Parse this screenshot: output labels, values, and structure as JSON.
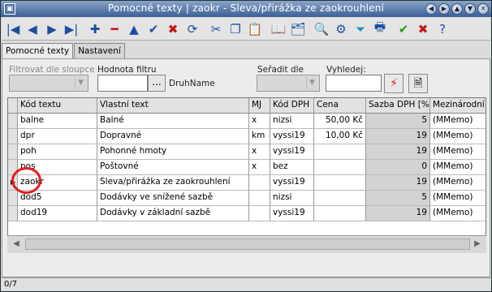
{
  "window": {
    "title": "Pomocné texty | zaokr - Sleva/přirážka ze zaokrouhlení",
    "icon": "app-icon"
  },
  "title_buttons": [
    "◀",
    "▶",
    "▲",
    "▼",
    "✕"
  ],
  "toolbar": [
    {
      "name": "first-record-icon",
      "glyph": "|◀"
    },
    {
      "name": "previous-record-icon",
      "glyph": "◀"
    },
    {
      "name": "next-record-icon",
      "glyph": "▶"
    },
    {
      "name": "last-record-icon",
      "glyph": "▶|"
    },
    {
      "name": "add-icon",
      "glyph": "✚"
    },
    {
      "name": "delete-icon",
      "glyph": "━"
    },
    {
      "name": "edit-icon",
      "glyph": "▲"
    },
    {
      "name": "confirm-icon",
      "glyph": "✔"
    },
    {
      "name": "cancel-icon",
      "glyph": "✖"
    },
    {
      "name": "refresh-icon",
      "glyph": "⟳"
    },
    {
      "name": "cut-icon",
      "glyph": "✂"
    },
    {
      "name": "copy-icon",
      "glyph": "❐"
    },
    {
      "name": "paste-icon",
      "glyph": "📋"
    },
    {
      "name": "book-icon",
      "glyph": "📖"
    },
    {
      "name": "folder-icon",
      "glyph": "🗂"
    },
    {
      "name": "search-icon",
      "glyph": "🔍"
    },
    {
      "name": "settings-icon",
      "glyph": "⚙"
    },
    {
      "name": "filter-icon",
      "glyph": "⏷"
    },
    {
      "name": "print-icon",
      "glyph": "🖶"
    },
    {
      "name": "ok-icon",
      "glyph": "✔"
    },
    {
      "name": "close-icon",
      "glyph": "✖"
    },
    {
      "name": "help-icon",
      "glyph": "?"
    }
  ],
  "tabs": [
    "Pomocné texty",
    "Nastavení"
  ],
  "filters": {
    "filter_column_label": "Filtrovat dle sloupce",
    "filter_value_label": "Hodnota filtru",
    "filter_value": "",
    "dots": "...",
    "druh_label": "DruhName",
    "sort_label": "Seřadit dle",
    "search_label": "Vyhledej:",
    "search_value": ""
  },
  "grid": {
    "columns": [
      "",
      "Kód textu",
      "Vlastní text",
      "MJ",
      "Kód DPH",
      "Cena",
      "Sazba DPH [%]",
      "Mezinárodní te"
    ],
    "rows": [
      [
        "",
        "balne",
        "Balné",
        "x",
        "nizsi",
        "50,00 Kč",
        "5",
        "(MMemo)"
      ],
      [
        "",
        "dpr",
        "Dopravné",
        "km",
        "vyssi19",
        "10,00 Kč",
        "19",
        "(MMemo)"
      ],
      [
        "",
        "poh",
        "Pohonné hmoty",
        "x",
        "vyssi19",
        "",
        "19",
        "(MMemo)"
      ],
      [
        "",
        "pos",
        "Poštovné",
        "x",
        "bez",
        "",
        "0",
        "(MMemo)"
      ],
      [
        "▶",
        "zaokr",
        "Sleva/přirážka ze zaokrouhlení",
        "",
        "vyssi19",
        "",
        "19",
        "(MMemo)"
      ],
      [
        "",
        "dod5",
        "Dodávky ve snížené sazbě",
        "",
        "nizsi",
        "",
        "5",
        "(MMemo)"
      ],
      [
        "",
        "dod19",
        "Dodávky v základní sazbě",
        "",
        "vyssi19",
        "",
        "19",
        "(MMemo)"
      ]
    ]
  },
  "status": {
    "text": "0/7"
  },
  "colors": {
    "title_bar": "#3c5f96",
    "highlight_circle": "#e81c1c"
  }
}
